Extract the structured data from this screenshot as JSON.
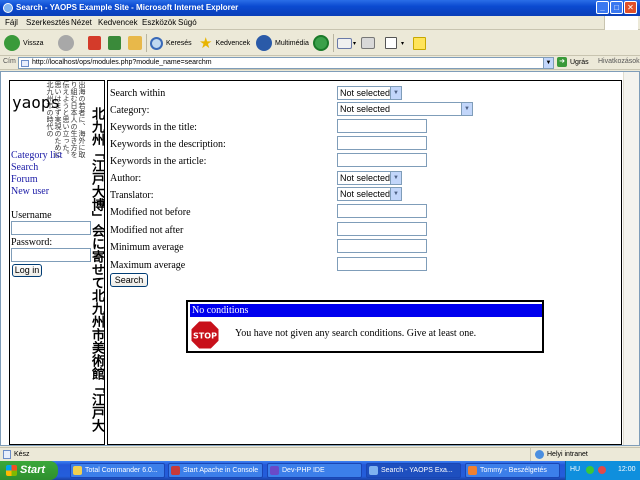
{
  "window": {
    "title": "Search - YAOPS Example Site - Microsoft Internet Explorer"
  },
  "menu": [
    "Fájl",
    "Szerkesztés",
    "Nézet",
    "Kedvencek",
    "Eszközök",
    "Súgó"
  ],
  "toolbar": {
    "back": "Vissza",
    "search": "Keresés",
    "favorites": "Kedvencek",
    "media": "Multimédia"
  },
  "address": {
    "label": "Cím",
    "url": "http://localhost/ops/modules.php?module_name=searchm",
    "go": "Ugrás",
    "links": "Hivatkozások"
  },
  "sidebar": {
    "logo": "yaops",
    "vertical_small": "出海の若者に、海外に取り組む日本人の生き方を伝えようと思い立った。思いはまず実現のために北九州市の時代の",
    "vertical_big": "北九州「江戸大博」会に寄せて北九州市美術館「江戸大",
    "links": [
      "Category list",
      "Search",
      "Forum",
      "New user"
    ],
    "username_label": "Username",
    "password_label": "Password:",
    "login_button": "Log in"
  },
  "form": {
    "fields": [
      {
        "label": "Search within",
        "type": "select",
        "value": "Not selected"
      },
      {
        "label": "Category:",
        "type": "select-wide",
        "value": "Not selected"
      },
      {
        "label": "Keywords in the title:",
        "type": "text",
        "value": ""
      },
      {
        "label": "Keywords in the description:",
        "type": "text",
        "value": ""
      },
      {
        "label": "Keywords in the article:",
        "type": "text",
        "value": ""
      },
      {
        "label": "Author:",
        "type": "select",
        "value": "Not selected"
      },
      {
        "label": "Translator:",
        "type": "select",
        "value": "Not selected"
      },
      {
        "label": "Modified not before",
        "type": "text",
        "value": ""
      },
      {
        "label": "Modified not after",
        "type": "text",
        "value": ""
      },
      {
        "label": "Minimum average",
        "type": "text",
        "value": ""
      },
      {
        "label": "Maximum average",
        "type": "text",
        "value": ""
      }
    ],
    "search_button": "Search"
  },
  "dialog": {
    "title": "No conditions",
    "stop_text": "STOP",
    "message": "You have not given any search conditions. Give at least one."
  },
  "status": {
    "text": "Kész",
    "zone": "Helyi intranet"
  },
  "taskbar": {
    "start": "Start",
    "tasks": [
      {
        "label": "Total Commander 6.0...",
        "active": false
      },
      {
        "label": "Start Apache in Console",
        "active": false
      },
      {
        "label": "Dev-PHP IDE",
        "active": false
      },
      {
        "label": "Search - YAOPS Exa...",
        "active": true
      },
      {
        "label": "Tommy - Beszélgetés",
        "active": false
      }
    ],
    "lang": "HU",
    "clock": "12:00"
  }
}
